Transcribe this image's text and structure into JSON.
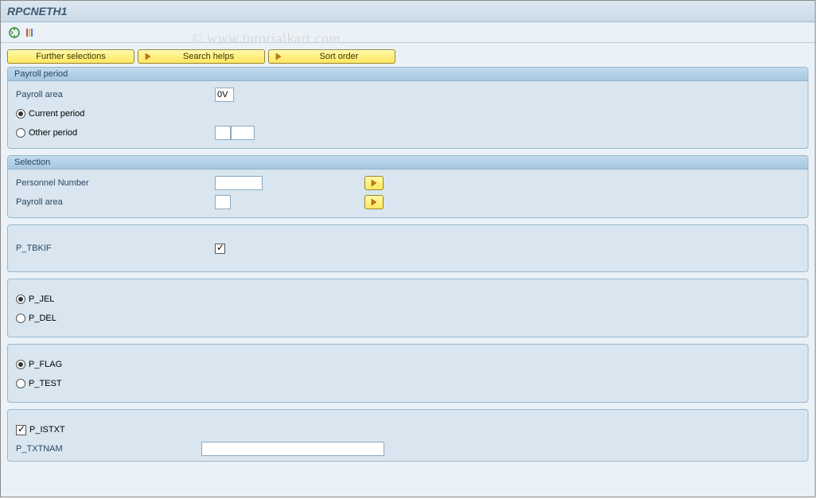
{
  "title": "RPCNETH1",
  "watermark": "© www.tutorialkart.com",
  "buttons": {
    "further_selections": "Further selections",
    "search_helps": "Search helps",
    "sort_order": "Sort order"
  },
  "groups": {
    "payroll_period": {
      "title": "Payroll period",
      "payroll_area_label": "Payroll area",
      "payroll_area_value": "0V",
      "current_period_label": "Current period",
      "other_period_label": "Other period",
      "selected": "current",
      "other_p1": "",
      "other_p2": ""
    },
    "selection": {
      "title": "Selection",
      "personnel_number_label": "Personnel Number",
      "personnel_number_value": "",
      "payroll_area_label": "Payroll area",
      "payroll_area_value": ""
    },
    "tbkif": {
      "label": "P_TBKIF",
      "checked": true
    },
    "jel": {
      "p_jel_label": "P_JEL",
      "p_del_label": "P_DEL",
      "selected": "p_jel"
    },
    "flag": {
      "p_flag_label": "P_FLAG",
      "p_test_label": "P_TEST",
      "selected": "p_flag"
    },
    "txt": {
      "p_istxt_label": "P_ISTXT",
      "p_istxt_checked": true,
      "p_txtnam_label": "P_TXTNAM",
      "p_txtnam_value": ""
    }
  }
}
